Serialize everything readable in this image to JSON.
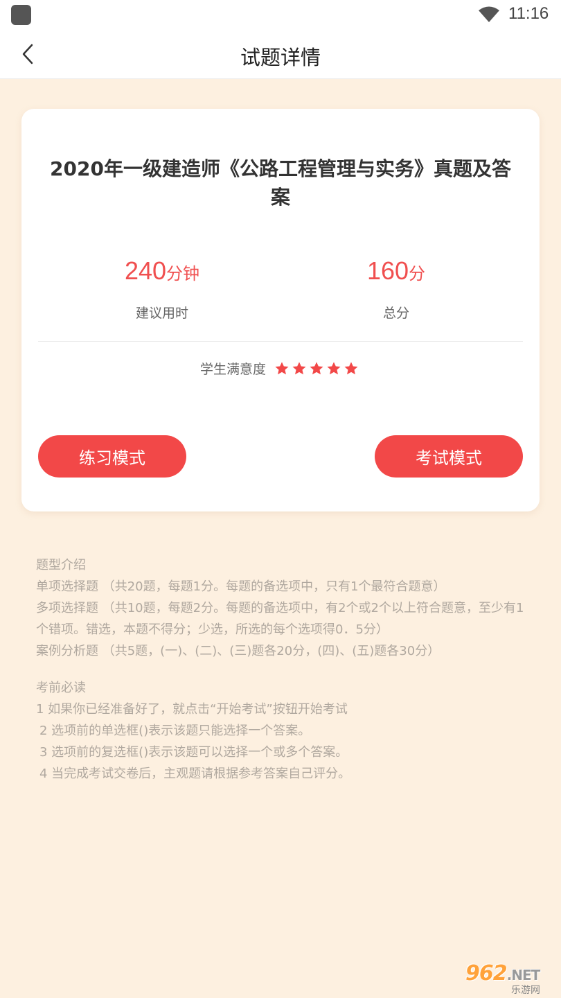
{
  "status_bar": {
    "time": "11:16"
  },
  "header": {
    "title": "试题详情"
  },
  "card": {
    "exam_title": "2020年一级建造师《公路工程管理与实务》真题及答案",
    "duration": {
      "value": "240",
      "unit": "分钟",
      "label": "建议用时"
    },
    "score": {
      "value": "160",
      "unit": "分",
      "label": "总分"
    },
    "satisfaction": {
      "label": "学生满意度",
      "rating": 5,
      "max": 5
    },
    "practice_button": "练习模式",
    "exam_button": "考试模式"
  },
  "intro": {
    "heading": "题型介绍",
    "lines": [
      "单项选择题 （共20题，每题1分。每题的备选项中，只有1个最符合题意）",
      "多项选择题 （共10题，每题2分。每题的备选项中，有2个或2个以上符合题意，至少有1个错项。错选，本题不得分；少选，所选的每个选项得0．5分）",
      "案例分析题 （共5题，(一)、(二)、(三)题各20分，(四)、(五)题各30分）"
    ]
  },
  "notice": {
    "heading": "考前必读",
    "lines": [
      "1 如果你已经准备好了，就点击“开始考试”按钮开始考试",
      "2 选项前的单选框()表示该题只能选择一个答案。",
      "3 选项前的复选框()表示该题可以选择一个或多个答案。",
      "4 当完成考试交卷后，主观题请根据参考答案自己评分。"
    ]
  },
  "watermark": {
    "main": "962",
    "net": ".NET",
    "sub": "乐游网"
  },
  "colors": {
    "accent": "#f24848",
    "background": "#fdf0e0"
  },
  "icons": {
    "back": "chevron-left-icon",
    "wifi": "wifi-icon",
    "star": "star-icon"
  }
}
